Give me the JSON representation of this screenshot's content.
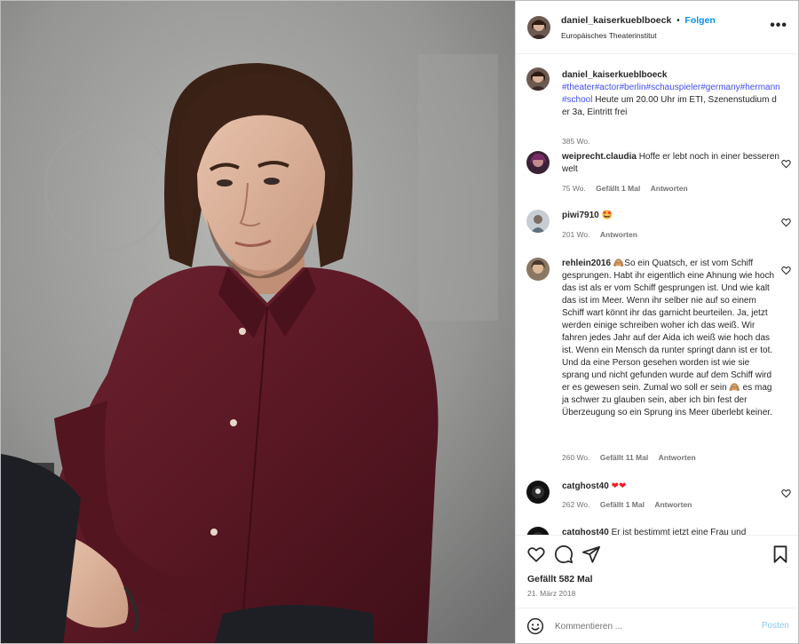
{
  "header": {
    "username": "daniel_kaiserkueblboeck",
    "separator": "•",
    "follow_label": "Folgen",
    "location": "Europäisches Theaterinstitut",
    "more_icon": "more-horizontal-icon",
    "more_label": "•••"
  },
  "caption": {
    "username": "daniel_kaiserkueblboeck",
    "hashtags": "#theater#actor#berlin#schauspieler#germany#hermann#school",
    "text": " Heute um 20.00 Uhr im ETI, Szenenstudium der 3a, Eintritt frei",
    "age": "385 Wo."
  },
  "comments": [
    {
      "username": "weiprecht.claudia",
      "text": "Hoffe er lebt noch in einer besseren welt",
      "age": "75 Wo.",
      "likes": "Gefällt 1 Mal",
      "reply": "Antworten"
    },
    {
      "username": "piwi7910",
      "text": "🤩",
      "age": "201 Wo.",
      "likes": "",
      "reply": "Antworten"
    },
    {
      "username": "rehlein2016",
      "text": "🙈So ein Quatsch, er ist vom Schiff gesprungen. Habt ihr eigentlich eine Ahnung wie hoch das ist als er vom Schiff gesprungen ist. Und wie kalt das ist im Meer. Wenn ihr selber nie auf so einem Schiff wart könnt ihr das garnicht beurteilen. Ja, jetzt werden einige schreiben woher ich das weiß. Wir fahren jedes Jahr auf der Aida ich weiß wie hoch das ist. Wenn ein Mensch da runter springt dann ist er tot. Und da eine Person gesehen worden ist wie sie sprang und nicht gefunden wurde auf dem Schiff wird er es gewesen sein. Zumal wo soll er sein 🙈 es mag ja schwer zu glauben sein, aber ich bin fest der Überzeugung so ein Sprung ins Meer überlebt keiner.",
      "age": "260 Wo.",
      "likes": "Gefällt 11 Mal",
      "reply": "Antworten"
    },
    {
      "username": "catghost40",
      "text": "❤❤",
      "age": "262 Wo.",
      "likes": "Gefällt 1 Mal",
      "reply": "Antworten"
    },
    {
      "username": "catghost40",
      "text": "Er ist bestimmt jetzt eine Frau und",
      "age": "",
      "likes": "",
      "reply": ""
    }
  ],
  "actions": {
    "like_icon": "heart-icon",
    "comment_icon": "comment-icon",
    "share_icon": "share-icon",
    "save_icon": "bookmark-icon",
    "likes": "Gefällt 582 Mal",
    "date": "21. März 2018"
  },
  "composer": {
    "emoji_icon": "emoji-icon",
    "placeholder": "Kommentieren ...",
    "post_label": "Posten"
  },
  "colors": {
    "link": "#0095f6",
    "hashtag": "#4150f7",
    "shirt": "#5e1a26",
    "wall": "#8e8f8e",
    "heart_red": "#ed1c24"
  }
}
